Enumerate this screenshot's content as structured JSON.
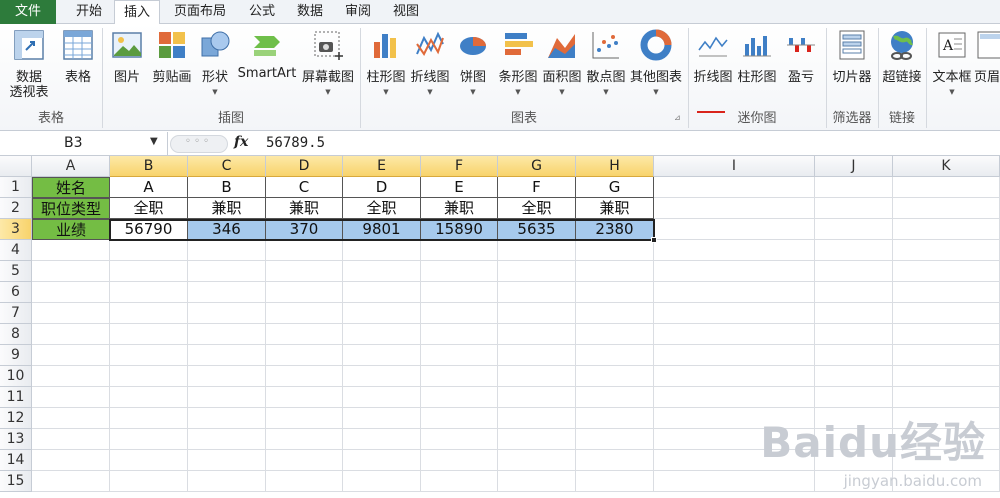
{
  "tabs": [
    {
      "label": "文件"
    },
    {
      "label": "开始"
    },
    {
      "label": "插入"
    },
    {
      "label": "页面布局"
    },
    {
      "label": "公式"
    },
    {
      "label": "数据"
    },
    {
      "label": "审阅"
    },
    {
      "label": "视图"
    }
  ],
  "ribbon": {
    "groups": {
      "tables": "表格",
      "illustrations": "插图",
      "charts": "图表",
      "sparklines": "迷你图",
      "filter": "筛选器",
      "links": "链接"
    },
    "buttons": {
      "pivot_line1": "数据",
      "pivot_line2": "透视表",
      "table": "表格",
      "picture": "图片",
      "clipart": "剪贴画",
      "shapes": "形状",
      "smartart": "SmartArt",
      "screenshot": "屏幕截图",
      "column": "柱形图",
      "line": "折线图",
      "pie": "饼图",
      "bar": "条形图",
      "area": "面积图",
      "scatter": "散点图",
      "other": "其他图表",
      "spark_line": "折线图",
      "spark_column": "柱形图",
      "spark_winloss": "盈亏",
      "slicer": "切片器",
      "hyperlink": "超链接",
      "textbox": "文本框",
      "header": "页眉"
    }
  },
  "formula_bar": {
    "name_box": "B3",
    "fx": "fx",
    "content": "56789.5"
  },
  "columns": [
    "A",
    "B",
    "C",
    "D",
    "E",
    "F",
    "G",
    "H",
    "I",
    "J",
    "K"
  ],
  "rows": [
    "1",
    "2",
    "3",
    "4",
    "5",
    "6",
    "7",
    "8",
    "9",
    "10",
    "11",
    "12",
    "13",
    "14",
    "15"
  ],
  "sheet": {
    "row1": [
      "姓名",
      "A",
      "B",
      "C",
      "D",
      "E",
      "F",
      "G"
    ],
    "row2": [
      "职位类型",
      "全职",
      "兼职",
      "兼职",
      "全职",
      "兼职",
      "全职",
      "兼职"
    ],
    "row3": [
      "业绩",
      "56790",
      "346",
      "370",
      "9801",
      "15890",
      "5635",
      "2380"
    ]
  },
  "watermark": {
    "main": "Baidu经验",
    "sub": "jingyan.baidu.com"
  },
  "colors": {
    "file_tab": "#2d7b3b",
    "header_fill": "#74bd44",
    "selection_fill": "#a6c9ec",
    "selected_header": "#f8d36b"
  }
}
